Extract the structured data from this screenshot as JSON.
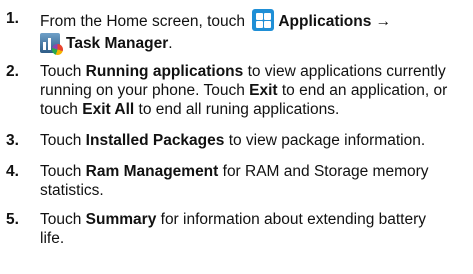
{
  "steps": [
    {
      "number": "1.",
      "line1": {
        "pre": "From the Home screen, touch",
        "icon": "applications-icon",
        "bold": "Applications",
        "arrow": "→"
      },
      "line2": {
        "icon": "task-manager-icon",
        "bold": "Task Manager",
        "post": "."
      }
    },
    {
      "number": "2.",
      "parts": [
        {
          "t": "Touch "
        },
        {
          "t": "Running applications",
          "b": true
        },
        {
          "t": " to view applications currently running on your phone. Touch "
        },
        {
          "t": "Exit",
          "b": true
        },
        {
          "t": " to end an application, or touch "
        },
        {
          "t": "Exit All",
          "b": true
        },
        {
          "t": " to end all runing applications."
        }
      ]
    },
    {
      "number": "3.",
      "parts": [
        {
          "t": "Touch "
        },
        {
          "t": "Installed Packages",
          "b": true
        },
        {
          "t": " to view package information."
        }
      ]
    },
    {
      "number": "4.",
      "parts": [
        {
          "t": "Touch "
        },
        {
          "t": "Ram Management",
          "b": true
        },
        {
          "t": " for RAM and Storage memory statistics."
        }
      ]
    },
    {
      "number": "5.",
      "parts": [
        {
          "t": "Touch "
        },
        {
          "t": "Summary",
          "b": true
        },
        {
          "t": " for information about extending battery life."
        }
      ]
    }
  ]
}
